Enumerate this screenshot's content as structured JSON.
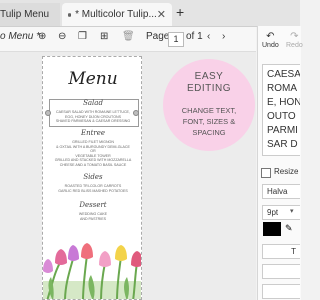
{
  "tabs": [
    {
      "label": "Tulip Menu"
    },
    {
      "label": "* Multicolor Tulip..."
    }
  ],
  "toolbar": {
    "doc_name": "o Menu *",
    "page_label": "Page",
    "page_value": "1",
    "page_of": "of 1"
  },
  "menu": {
    "title": "Menu",
    "sections": [
      {
        "title": "Salad",
        "body": [
          "CAESAR SALAD WITH ROMAINE LETTUCE,",
          "EGG, HONEY DIJON CROUTONS",
          "SHAVED PARMESAN & CAESAR DRESSING"
        ]
      },
      {
        "title": "Entree",
        "body": [
          "GRILLED FILET MIGNON",
          "& OXTAIL WITH A BURGUNDY DEMI-GLACE",
          "OR",
          "VEGETABLE TOWER",
          "GRILLED AND STACKED WITH MOZZARELLA",
          "CHEESE AND A TOMATO BASIL SAUCE"
        ]
      },
      {
        "title": "Sides",
        "body": [
          "ROASTED TRI-COLOR CARROTS",
          "GARLIC RED BLISS MASHED POTATOES"
        ]
      },
      {
        "title": "Dessert",
        "body": [
          "WEDDING CAKE",
          "AND PASTRIES"
        ]
      }
    ]
  },
  "promo": {
    "line1": "EASY",
    "line2": "EDITING",
    "line3": "CHANGE TEXT,",
    "line4": "FONT, SIZES &",
    "line5": "SPACING"
  },
  "right_panel": {
    "undo": "Undo",
    "redo": "Redo",
    "text_lines": [
      "CAESA",
      "ROMA",
      "E, HON",
      "OUTO",
      "PARMI",
      "SAR D"
    ],
    "resize_label": "Resize",
    "font_name": "Halva",
    "font_size": "9pt",
    "color": "#000000",
    "bottom_label": "T"
  }
}
